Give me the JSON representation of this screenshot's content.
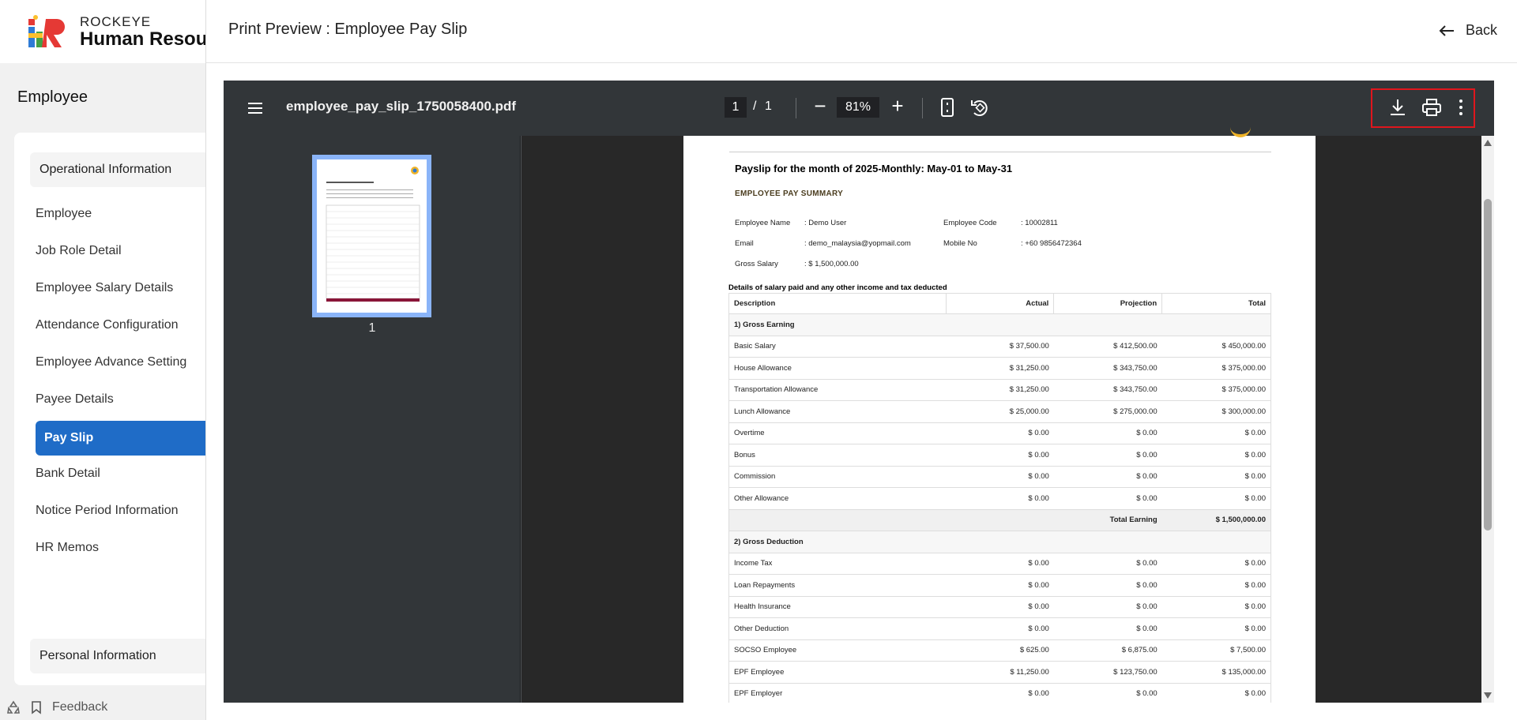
{
  "brand": {
    "top": "ROCKEYE",
    "main": "Human Resou"
  },
  "section_title": "Employee",
  "sidebar": {
    "operational_header": "Operational Information",
    "items": [
      {
        "label": "Employee"
      },
      {
        "label": "Job Role Detail"
      },
      {
        "label": "Employee Salary Details"
      },
      {
        "label": "Attendance Configuration"
      },
      {
        "label": "Employee Advance Setting"
      },
      {
        "label": "Payee Details"
      },
      {
        "label": "Pay Slip"
      },
      {
        "label": "Bank Detail"
      },
      {
        "label": "Notice Period Information"
      },
      {
        "label": "HR Memos"
      }
    ],
    "personal_header": "Personal Information"
  },
  "bottom_bar": {
    "feedback": "Feedback"
  },
  "modal": {
    "title": "Print Preview : Employee Pay Slip",
    "back": "Back"
  },
  "viewer": {
    "file_name": "employee_pay_slip_1750058400.pdf",
    "page_current": "1",
    "page_sep": "/",
    "page_total": "1",
    "zoom": "81%",
    "zoom_out": "−",
    "zoom_in": "+",
    "thumb_number": "1"
  },
  "document": {
    "title": "Payslip for the month of 2025-Monthly: May-01 to May-31",
    "summary_heading": "EMPLOYEE PAY SUMMARY",
    "employee_name_label": "Employee Name",
    "employee_name": ": Demo User",
    "employee_code_label": "Employee Code",
    "employee_code": ": 10002811",
    "email_label": "Email",
    "email": ": demo_malaysia@yopmail.com",
    "mobile_label": "Mobile No",
    "mobile": ": +60 9856472364",
    "gross_label": "Gross Salary",
    "gross": ": $ 1,500,000.00",
    "details_heading": "Details of salary paid and any other income and tax deducted",
    "columns": [
      "Description",
      "Actual",
      "Projection",
      "Total"
    ],
    "gross_earning_title": "1) Gross Earning",
    "earnings": [
      {
        "desc": "Basic Salary",
        "actual": "$ 37,500.00",
        "projection": "$ 412,500.00",
        "total": "$ 450,000.00"
      },
      {
        "desc": "House Allowance",
        "actual": "$ 31,250.00",
        "projection": "$ 343,750.00",
        "total": "$ 375,000.00"
      },
      {
        "desc": "Transportation Allowance",
        "actual": "$ 31,250.00",
        "projection": "$ 343,750.00",
        "total": "$ 375,000.00"
      },
      {
        "desc": "Lunch Allowance",
        "actual": "$ 25,000.00",
        "projection": "$ 275,000.00",
        "total": "$ 300,000.00"
      },
      {
        "desc": "Overtime",
        "actual": "$ 0.00",
        "projection": "$ 0.00",
        "total": "$ 0.00"
      },
      {
        "desc": "Bonus",
        "actual": "$ 0.00",
        "projection": "$ 0.00",
        "total": "$ 0.00"
      },
      {
        "desc": "Commission",
        "actual": "$ 0.00",
        "projection": "$ 0.00",
        "total": "$ 0.00"
      },
      {
        "desc": "Other Allowance",
        "actual": "$ 0.00",
        "projection": "$ 0.00",
        "total": "$ 0.00"
      }
    ],
    "total_earning_label": "Total Earning",
    "total_earning": "$ 1,500,000.00",
    "gross_deduction_title": "2) Gross Deduction",
    "deductions": [
      {
        "desc": "Income Tax",
        "actual": "$ 0.00",
        "projection": "$ 0.00",
        "total": "$ 0.00"
      },
      {
        "desc": "Loan Repayments",
        "actual": "$ 0.00",
        "projection": "$ 0.00",
        "total": "$ 0.00"
      },
      {
        "desc": "Health Insurance",
        "actual": "$ 0.00",
        "projection": "$ 0.00",
        "total": "$ 0.00"
      },
      {
        "desc": "Other Deduction",
        "actual": "$ 0.00",
        "projection": "$ 0.00",
        "total": "$ 0.00"
      },
      {
        "desc": "SOCSO Employee",
        "actual": "$ 625.00",
        "projection": "$ 6,875.00",
        "total": "$ 7,500.00"
      },
      {
        "desc": "EPF Employee",
        "actual": "$ 11,250.00",
        "projection": "$ 123,750.00",
        "total": "$ 135,000.00"
      },
      {
        "desc": "EPF Employer",
        "actual": "$ 0.00",
        "projection": "$ 0.00",
        "total": "$ 0.00"
      }
    ]
  },
  "colors": {
    "accent": "#1f6cc7",
    "toolbar": "#323639",
    "highlight_box": "#e0161d",
    "thumb_border": "#8ab4f8"
  }
}
